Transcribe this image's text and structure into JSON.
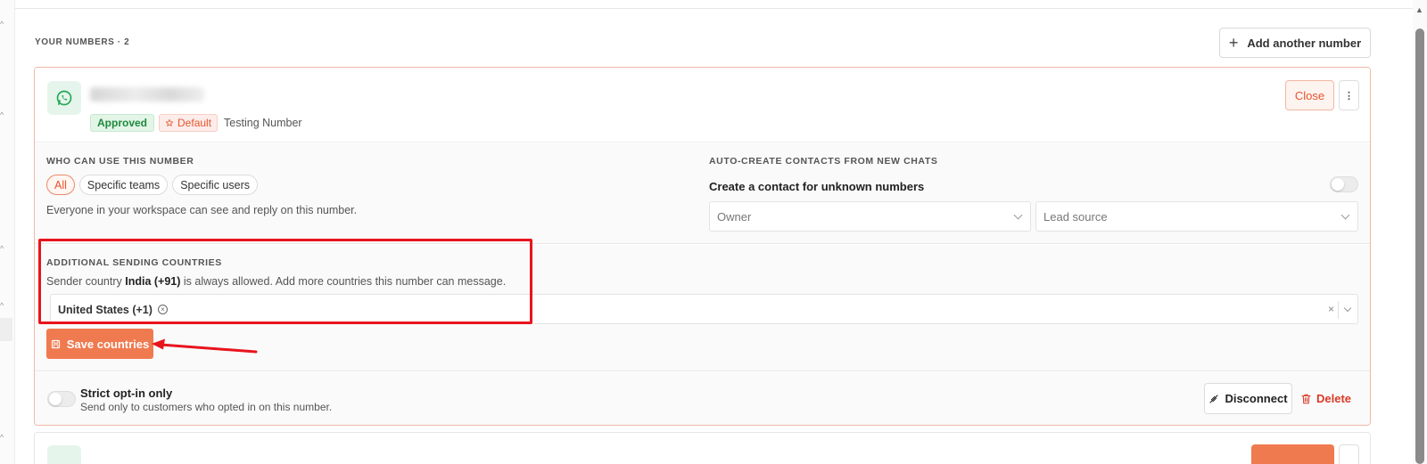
{
  "section": {
    "heading": "YOUR NUMBERS · 2",
    "add_button_label": "Add another number"
  },
  "number_card": {
    "status_approved": "Approved",
    "default_label": "Default",
    "number_name": "Testing Number",
    "close_label": "Close",
    "who_can_use": {
      "title": "WHO CAN USE THIS NUMBER",
      "options": [
        "All",
        "Specific teams",
        "Specific users"
      ],
      "selected": "All",
      "description": "Everyone in your workspace can see and reply on this number."
    },
    "auto_create": {
      "title": "AUTO-CREATE CONTACTS FROM NEW CHATS",
      "toggle_label": "Create a contact for unknown numbers",
      "toggle_on": false,
      "owner_placeholder": "Owner",
      "lead_source_placeholder": "Lead source"
    },
    "sending_countries": {
      "title": "ADDITIONAL SENDING COUNTRIES",
      "desc_prefix": "Sender country ",
      "desc_country": "India (+91)",
      "desc_suffix": " is always allowed. Add more countries this number can message.",
      "selected_countries": [
        "United States (+1)"
      ],
      "save_label": "Save countries"
    },
    "strict_optin": {
      "title": "Strict opt-in only",
      "description": "Send only to customers who opted in on this number.",
      "enabled": false
    },
    "disconnect_label": "Disconnect",
    "delete_label": "Delete"
  },
  "colors": {
    "accent": "#f07a4f",
    "danger": "#d93a26",
    "success": "#1e8a3e",
    "annotation": "#e8141d"
  },
  "icons": {
    "whatsapp": "whatsapp-icon",
    "plus": "plus-icon",
    "star": "star-icon",
    "save": "floppy-icon",
    "disconnect": "unplug-icon",
    "delete": "trash-icon"
  }
}
